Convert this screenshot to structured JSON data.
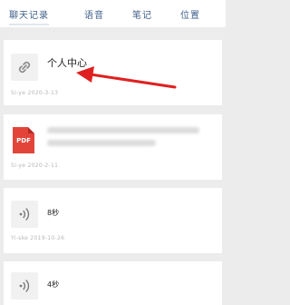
{
  "tabs": [
    {
      "label": "聊天记录"
    },
    {
      "label": "语音"
    },
    {
      "label": "笔记"
    },
    {
      "label": "位置"
    }
  ],
  "items": [
    {
      "type": "link",
      "icon": "link-icon",
      "title": "个人中心",
      "meta": "Si-ye 2020-3-13"
    },
    {
      "type": "pdf",
      "icon": "pdf-icon",
      "badge": "PDF",
      "meta": "Si-ye 2020-2-11"
    },
    {
      "type": "voice",
      "icon": "voice-icon",
      "title": "8秒",
      "meta": "Yi-ske 2019-10-26"
    },
    {
      "type": "voice",
      "icon": "voice-icon",
      "title": "4秒",
      "meta": ""
    }
  ],
  "colors": {
    "tab_text": "#3f5f8a",
    "annotation_arrow": "#e02020",
    "pdf_badge": "#e3443a"
  }
}
